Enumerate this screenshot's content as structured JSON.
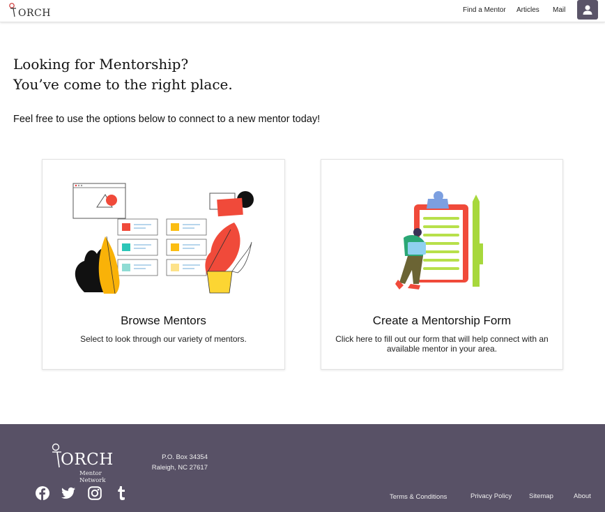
{
  "header": {
    "logo_text": "ORCH",
    "nav": {
      "find_mentor": "Find a Mentor",
      "articles": "Articles",
      "mail": "Mail"
    },
    "account_icon": "person-icon"
  },
  "hero": {
    "title_line1": "Looking for Mentorship?",
    "title_line2": "You’ve come to the right place.",
    "subtitle": "Feel free to use the options below to connect to a new mentor today!"
  },
  "cards": [
    {
      "title": "Browse Mentors",
      "description": "Select to look through our variety of mentors."
    },
    {
      "title": "Create a Mentorship Form",
      "description": "Click here to fill out our form that will help connect with an available mentor in your area."
    }
  ],
  "footer": {
    "logo_text": "ORCH",
    "logo_sub": "Mentor Network",
    "address_line1": "P.O. Box 34354",
    "address_line2": "Raleigh, NC 27617",
    "social": [
      "facebook-icon",
      "twitter-icon",
      "instagram-icon",
      "tumblr-icon"
    ],
    "links": {
      "terms": "Terms & Conditions",
      "privacy": "Privacy Policy",
      "sitemap": "Sitemap",
      "about": "About"
    }
  },
  "colors": {
    "footer_bg": "#585166",
    "account_bg": "#5a5468"
  }
}
